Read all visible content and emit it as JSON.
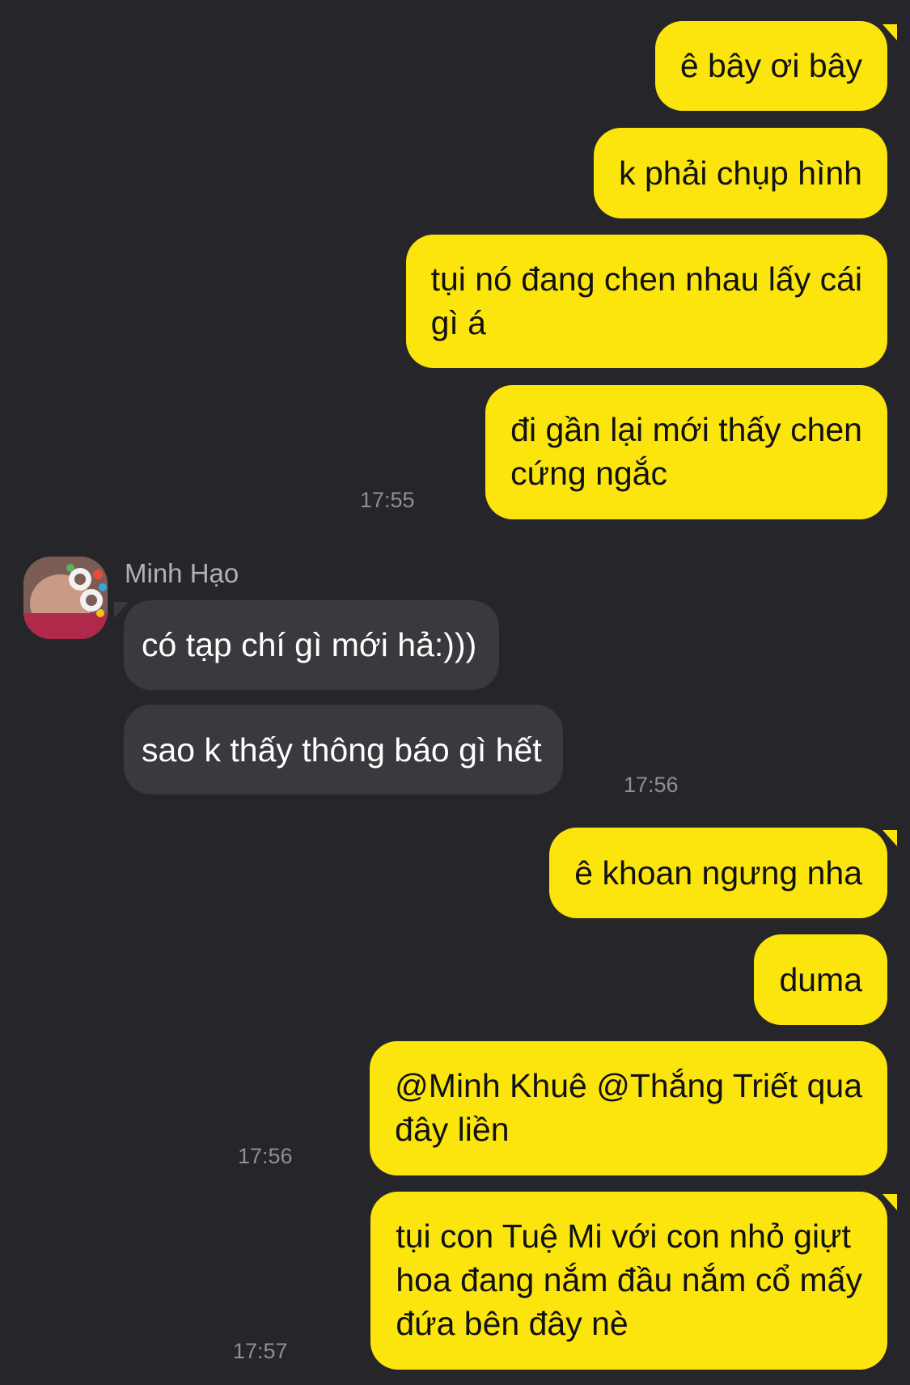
{
  "colors": {
    "background": "#26262a",
    "outgoing_bubble": "#fbe50c",
    "incoming_bubble": "#3a3a3e",
    "timestamp": "#8e8e93"
  },
  "messages": [
    {
      "direction": "outgoing",
      "lines": [
        "ê bây ơi bây"
      ]
    },
    {
      "direction": "outgoing",
      "lines": [
        "k phải chụp hình"
      ]
    },
    {
      "direction": "outgoing",
      "lines": [
        "tụi nó đang chen nhau lấy cái",
        "gì á"
      ]
    },
    {
      "direction": "outgoing",
      "lines": [
        "đi gần lại mới thấy chen",
        "cứng ngắc"
      ],
      "time": "17:55"
    },
    {
      "direction": "incoming",
      "sender": "Minh Hạo",
      "avatar": "user-avatar-photo",
      "lines": [
        "có tạp chí gì mới hả:)))"
      ]
    },
    {
      "direction": "incoming",
      "lines": [
        "sao k thấy thông báo gì hết"
      ],
      "time": "17:56"
    },
    {
      "direction": "outgoing",
      "lines": [
        "ê khoan ngưng nha"
      ]
    },
    {
      "direction": "outgoing",
      "lines": [
        "duma"
      ]
    },
    {
      "direction": "outgoing",
      "lines": [
        "@Minh Khuê @Thắng Triết qua",
        "đây liền"
      ],
      "time": "17:56"
    },
    {
      "direction": "outgoing",
      "lines": [
        "tụi con Tuệ Mi với con nhỏ giựt",
        "hoa đang nắm đầu nắm cổ mấy",
        "đứa bên đây nè"
      ],
      "time": "17:57"
    }
  ]
}
